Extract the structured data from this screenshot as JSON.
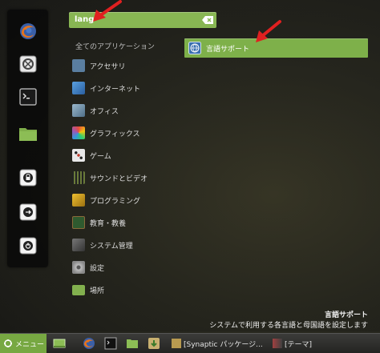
{
  "search": {
    "query": "lang"
  },
  "categories": {
    "header": "全てのアプリケーション",
    "items": [
      {
        "label": "アクセサリ",
        "icon": "accessories-icon",
        "color": "#5a7ea0"
      },
      {
        "label": "インターネット",
        "icon": "internet-icon",
        "color": "#3f7fc2"
      },
      {
        "label": "オフィス",
        "icon": "office-icon",
        "color": "#6f8fa8"
      },
      {
        "label": "グラフィックス",
        "icon": "graphics-icon",
        "color": "#c0392b"
      },
      {
        "label": "ゲーム",
        "icon": "games-icon",
        "color": "#d8d8d8"
      },
      {
        "label": "サウンドとビデオ",
        "icon": "multimedia-icon",
        "color": "#4a5a2a"
      },
      {
        "label": "プログラミング",
        "icon": "programming-icon",
        "color": "#c8a020"
      },
      {
        "label": "教育・教養",
        "icon": "education-icon",
        "color": "#3a6a3a"
      },
      {
        "label": "システム管理",
        "icon": "system-icon",
        "color": "#555555"
      },
      {
        "label": "設定",
        "icon": "settings-icon",
        "color": "#8a8a8a"
      },
      {
        "label": "場所",
        "icon": "places-folder-icon",
        "color": "#82b04e"
      }
    ]
  },
  "results": [
    {
      "label": "言語サポート",
      "icon": "language-support-icon"
    }
  ],
  "description": {
    "title": "言語サポート",
    "text": "システムで利用する各言語と母国語を設定します"
  },
  "panel": {
    "menu_label": "メニュー",
    "tasks": [
      {
        "label": "[Synaptic パッケージ..."
      },
      {
        "label": "[テーマ]"
      }
    ]
  },
  "colors": {
    "accent_green": "#7eb04a",
    "arrow_red": "#e02020"
  }
}
